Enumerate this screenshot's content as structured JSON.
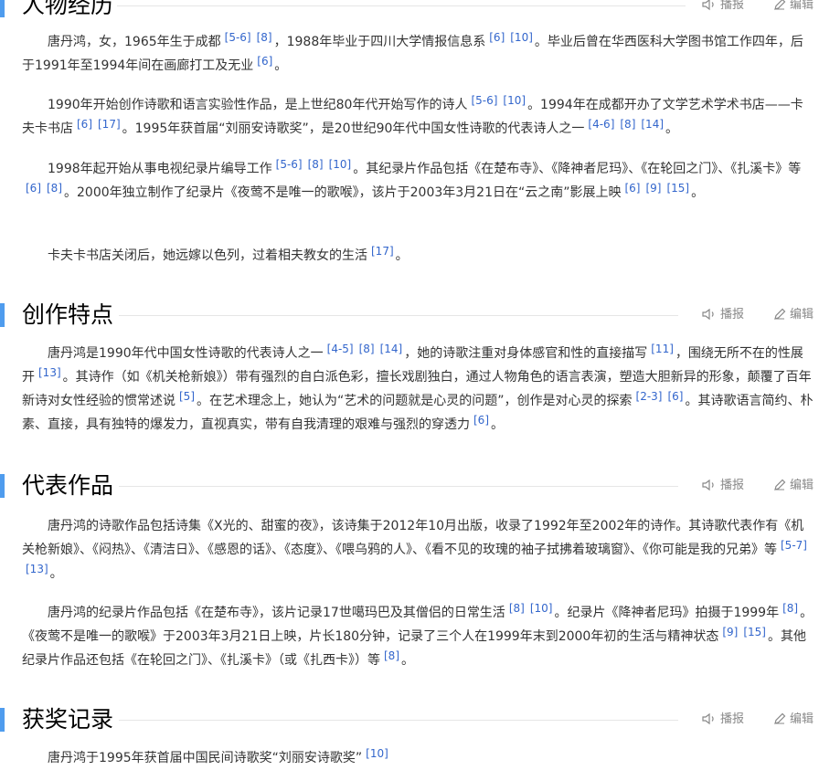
{
  "sections": [
    {
      "title": "人物经历",
      "report_label": "播报",
      "edit_label": "编辑",
      "paragraphs": [
        [
          {
            "t": "唐丹鸿，女，1965年生于成都"
          },
          {
            "r": "[5-6]"
          },
          {
            "r": "[8]"
          },
          {
            "t": "，1988年毕业于四川大学情报信息系"
          },
          {
            "r": "[6]"
          },
          {
            "r": "[10]"
          },
          {
            "t": "。毕业后曾在华西医科大学图书馆工作四年，后于1991年至1994年间在画廊打工及无业"
          },
          {
            "r": "[6]"
          },
          {
            "t": "。"
          }
        ],
        [
          {
            "t": "1990年开始创作诗歌和语言实验性作品，是上世纪80年代开始写作的诗人"
          },
          {
            "r": "[5-6]"
          },
          {
            "r": "[10]"
          },
          {
            "t": "。1994年在成都开办了文学艺术学术书店——卡夫卡书店"
          },
          {
            "r": "[6]"
          },
          {
            "r": "[17]"
          },
          {
            "t": "。1995年获首届“刘丽安诗歌奖”，是20世纪90年代中国女性诗歌的代表诗人之一"
          },
          {
            "r": "[4-6]"
          },
          {
            "r": "[8]"
          },
          {
            "r": "[14]"
          },
          {
            "t": "。"
          }
        ],
        [
          {
            "t": "1998年起开始从事电视纪录片编导工作"
          },
          {
            "r": "[5-6]"
          },
          {
            "r": "[8]"
          },
          {
            "r": "[10]"
          },
          {
            "t": "。其纪录片作品包括《在楚布寺》、《降神者尼玛》、《在轮回之门》、《扎溪卡》等"
          },
          {
            "r": "[6]"
          },
          {
            "r": "[8]"
          },
          {
            "t": "。2000年独立制作了纪录片《夜莺不是唯一的歌喉》，该片于2003年3月21日在“云之南”影展上映"
          },
          {
            "r": "[6]"
          },
          {
            "r": "[9]"
          },
          {
            "r": "[15]"
          },
          {
            "t": "。"
          }
        ],
        [
          {
            "t": "卡夫卡书店关闭后，她远嫁以色列，过着相夫教女的生活"
          },
          {
            "r": "[17]"
          },
          {
            "t": "。"
          }
        ]
      ]
    },
    {
      "title": "创作特点",
      "report_label": "播报",
      "edit_label": "编辑",
      "paragraphs": [
        [
          {
            "t": "唐丹鸿是1990年代中国女性诗歌的代表诗人之一"
          },
          {
            "r": "[4-5]"
          },
          {
            "r": "[8]"
          },
          {
            "r": "[14]"
          },
          {
            "t": "，她的诗歌注重对身体感官和性的直接描写"
          },
          {
            "r": "[11]"
          },
          {
            "t": "，围绕无所不在的性展开"
          },
          {
            "r": "[13]"
          },
          {
            "t": "。其诗作（如《机关枪新娘》）带有强烈的自白派色彩，擅长戏剧独白，通过人物角色的语言表演，塑造大胆新异的形象，颠覆了百年新诗对女性经验的惯常述说"
          },
          {
            "r": "[5]"
          },
          {
            "t": "。在艺术理念上，她认为“艺术的问题就是心灵的问题”，创作是对心灵的探索"
          },
          {
            "r": "[2-3]"
          },
          {
            "r": "[6]"
          },
          {
            "t": "。其诗歌语言简约、朴素、直接，具有独特的爆发力，直视真实，带有自我清理的艰难与强烈的穿透力"
          },
          {
            "r": "[6]"
          },
          {
            "t": "。"
          }
        ]
      ]
    },
    {
      "title": "代表作品",
      "report_label": "播报",
      "edit_label": "编辑",
      "paragraphs": [
        [
          {
            "t": "唐丹鸿的诗歌作品包括诗集《X光的、甜蜜的夜》，该诗集于2012年10月出版，收录了1992年至2002年的诗作。其诗歌代表作有《机关枪新娘》、《闷热》、《清洁日》、《感恩的话》、《态度》、《喂乌鸦的人》、《看不见的玫瑰的袖子拭拂着玻璃窗》、《你可能是我的兄弟》等"
          },
          {
            "r": "[5-7]"
          },
          {
            "r": "[13]"
          },
          {
            "t": "。"
          }
        ],
        [
          {
            "t": "唐丹鸿的纪录片作品包括《在楚布寺》，该片记录17世噶玛巴及其僧侣的日常生活"
          },
          {
            "r": "[8]"
          },
          {
            "r": "[10]"
          },
          {
            "t": "。纪录片《降神者尼玛》拍摄于1999年"
          },
          {
            "r": "[8]"
          },
          {
            "t": "。《夜莺不是唯一的歌喉》于2003年3月21日上映，片长180分钟，记录了三个人在1999年末到2000年初的生活与精神状态"
          },
          {
            "r": "[9]"
          },
          {
            "r": "[15]"
          },
          {
            "t": "。其他纪录片作品还包括《在轮回之门》、《扎溪卡》（或《扎西卡》）等"
          },
          {
            "r": "[8]"
          },
          {
            "t": "。"
          }
        ]
      ]
    },
    {
      "title": "获奖记录",
      "report_label": "播报",
      "edit_label": "编辑",
      "paragraphs": [
        [
          {
            "t": "唐丹鸿于1995年获首届中国民间诗歌奖“刘丽安诗歌奖”"
          },
          {
            "r": "[10]"
          }
        ]
      ]
    }
  ],
  "colors": {
    "accent_bar": "#4f9cee",
    "citation": "#3366cc",
    "body_text": "#333333",
    "tool_text": "#888888"
  },
  "icons": {
    "report": "speaker-icon",
    "edit": "pencil-icon"
  }
}
